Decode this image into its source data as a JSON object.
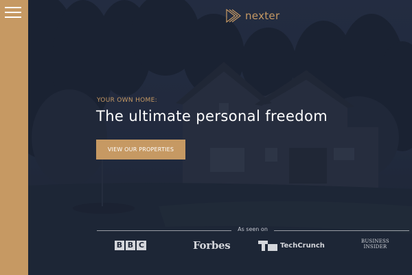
{
  "brand": {
    "name": "nexter",
    "icon": "play-triangles-icon",
    "accent_color": "#c69963"
  },
  "nav": {
    "menu_icon": "hamburger-menu-icon"
  },
  "hero": {
    "eyebrow": "YOUR OWN HOME:",
    "headline": "The ultimate personal freedom",
    "cta_label": "VIEW OUR PROPERTIES"
  },
  "press": {
    "label": "As seen on",
    "bbc_letters": [
      "B",
      "B",
      "C"
    ],
    "forbes": "Forbes",
    "techcrunch": "TechCrunch",
    "business_insider_line1": "BUSINESS",
    "business_insider_line2": "INSIDER"
  },
  "colors": {
    "sidebar": "#c69963",
    "overlay": "#1d2433",
    "text": "#ffffff"
  }
}
